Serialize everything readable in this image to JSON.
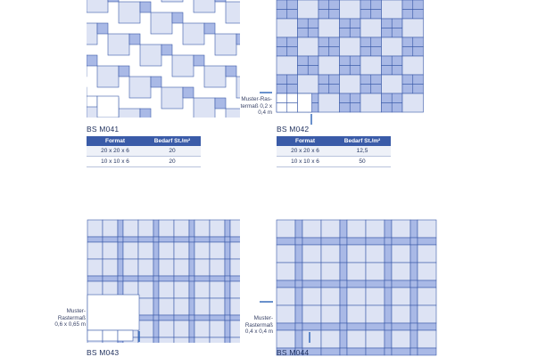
{
  "colors": {
    "light_tile": "#dde3f4",
    "blue_tile": "#a9b9e6",
    "outline": "#3b5aa8",
    "marker": "#2a62b6"
  },
  "patterns": [
    {
      "title": "BS M041",
      "headers": [
        "Format",
        "Bedarf St./m²"
      ],
      "rows": [
        [
          "20 x 20 x 6",
          "20"
        ],
        [
          "10 x 10 x 6",
          "20"
        ]
      ]
    },
    {
      "title": "BS M042",
      "note_lines": [
        "Muster-Ras-",
        "termaß 0,2 x",
        "0,4 m"
      ],
      "headers": [
        "Format",
        "Bedarf St./m²"
      ],
      "rows": [
        [
          "20 x 20 x 6",
          "12,5"
        ],
        [
          "10 x 10 x 6",
          "50"
        ]
      ]
    },
    {
      "title": "BS M043",
      "note_lines": [
        "Muster-",
        "Rastermaß",
        "0,6 x 0,65 m"
      ]
    },
    {
      "title": "BS M044",
      "note_lines": [
        "Muster-",
        "Rastermaß",
        "0,4 x 0,4 m"
      ]
    }
  ]
}
